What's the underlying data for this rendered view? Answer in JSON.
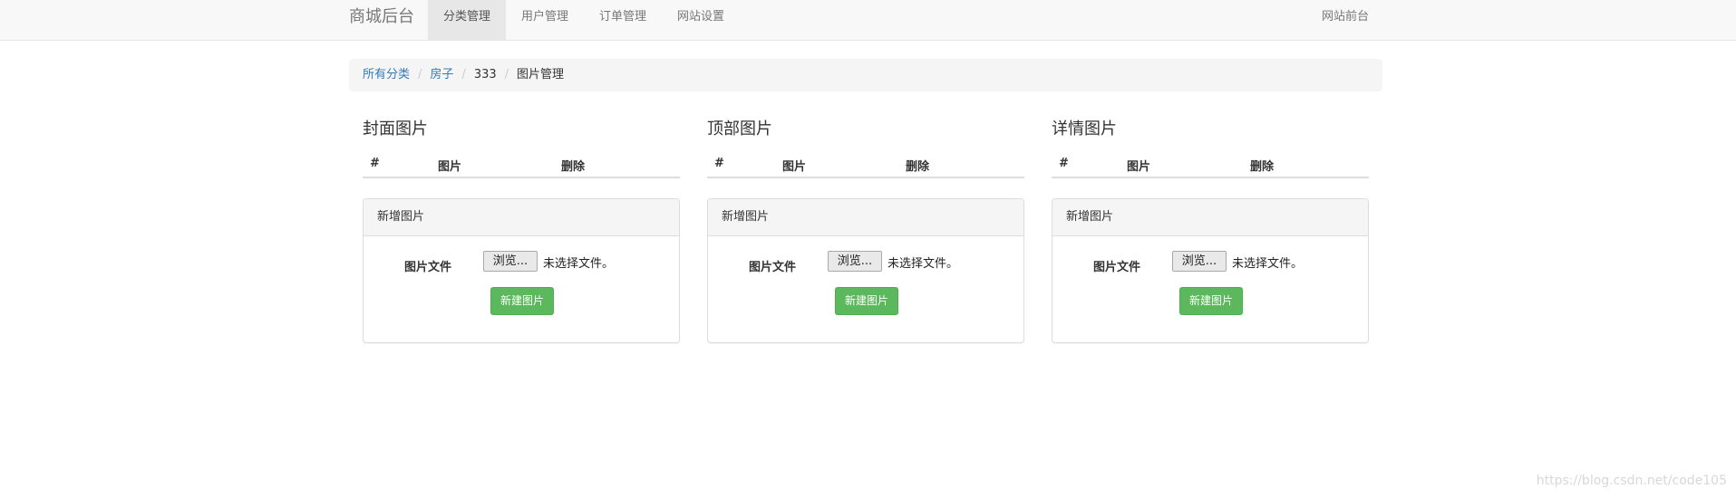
{
  "navbar": {
    "brand": "商城后台",
    "items": [
      {
        "label": "分类管理",
        "active": true
      },
      {
        "label": "用户管理",
        "active": false
      },
      {
        "label": "订单管理",
        "active": false
      },
      {
        "label": "网站设置",
        "active": false
      }
    ],
    "right_link": "网站前台"
  },
  "breadcrumb": {
    "items": [
      {
        "label": "所有分类",
        "link": true
      },
      {
        "label": "房子",
        "link": true
      },
      {
        "label": "333",
        "link": false
      },
      {
        "label": "图片管理",
        "link": false
      }
    ],
    "separator": "/"
  },
  "columns": [
    {
      "title": "封面图片",
      "headers": [
        "#",
        "图片",
        "删除"
      ],
      "panel": {
        "heading": "新增图片",
        "field_label": "图片文件",
        "browse_label": "浏览...",
        "file_status": "未选择文件。",
        "submit_label": "新建图片"
      }
    },
    {
      "title": "顶部图片",
      "headers": [
        "#",
        "图片",
        "删除"
      ],
      "panel": {
        "heading": "新增图片",
        "field_label": "图片文件",
        "browse_label": "浏览...",
        "file_status": "未选择文件。",
        "submit_label": "新建图片"
      }
    },
    {
      "title": "详情图片",
      "headers": [
        "#",
        "图片",
        "删除"
      ],
      "panel": {
        "heading": "新增图片",
        "field_label": "图片文件",
        "browse_label": "浏览...",
        "file_status": "未选择文件。",
        "submit_label": "新建图片"
      }
    }
  ],
  "watermark": "https://blog.csdn.net/code105",
  "colors": {
    "link": "#337ab7",
    "success": "#5cb85c",
    "navbar_bg": "#f8f8f8",
    "active_nav_bg": "#e7e7e7"
  }
}
